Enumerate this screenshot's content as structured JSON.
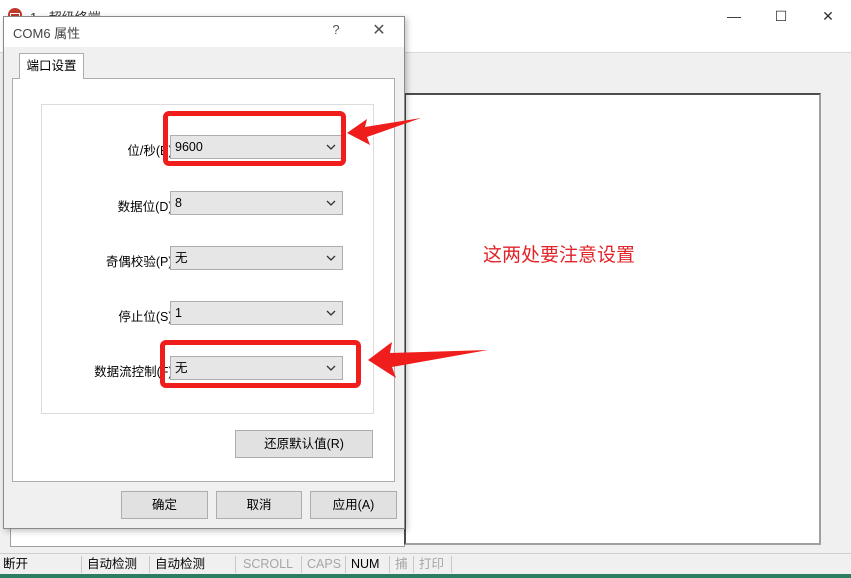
{
  "main_window": {
    "title": "1 - 超级终端",
    "minimize_label": "—",
    "maximize_label": "☐",
    "close_label": "✕"
  },
  "annotation": {
    "note": "这两处要注意设置",
    "color": "#e0242a"
  },
  "dialog": {
    "title": "COM6 属性",
    "help_label": "?",
    "close_label": "✕",
    "tab_label": "端口设置",
    "fields": [
      {
        "label": "位/秒(B):",
        "value": "9600"
      },
      {
        "label": "数据位(D):",
        "value": "8"
      },
      {
        "label": "奇偶校验(P):",
        "value": "无"
      },
      {
        "label": "停止位(S):",
        "value": "1"
      },
      {
        "label": "数据流控制(F):",
        "value": "无"
      }
    ],
    "restore_defaults_label": "还原默认值(R)",
    "ok_label": "确定",
    "cancel_label": "取消",
    "apply_label": "应用(A)"
  },
  "statusbar": {
    "cells": [
      {
        "text": "断开",
        "enabled": true
      },
      {
        "text": "自动检测",
        "enabled": true
      },
      {
        "text": "自动检测",
        "enabled": true
      },
      {
        "text": "SCROLL",
        "enabled": false
      },
      {
        "text": "CAPS",
        "enabled": false
      },
      {
        "text": "NUM",
        "enabled": true
      },
      {
        "text": "捕",
        "enabled": false
      },
      {
        "text": "打印",
        "enabled": false
      }
    ]
  },
  "icons": {
    "app": "phone-icon",
    "dropdown": "chevron-down-icon",
    "arrow": "red-arrow-icon"
  }
}
